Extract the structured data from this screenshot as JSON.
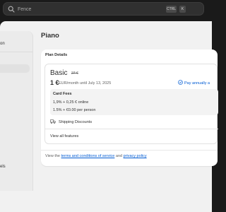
{
  "search": {
    "placeholder": "Fence",
    "shortcut_ctrl": "CTRL",
    "shortcut_key": "K"
  },
  "sidebar": {
    "item_top_fragment": "on",
    "item_bottom_fragment": "els"
  },
  "page": {
    "title": "Piano"
  },
  "plan_details": {
    "section_title": "Plan Details",
    "plan_name": "Basic",
    "old_price": "27 €",
    "price": "1 €",
    "price_note": "EUR/month until July 13, 2025",
    "pay_annually_label": "Pay annually a",
    "card_fees": {
      "title": "Card Fees",
      "online": "1,9% + 0,25 € online",
      "in_person": "1.5% + €0.00 per person"
    },
    "shipping_label": "Shipping Discounts",
    "view_all_label": "View all features"
  },
  "footer": {
    "prefix": "View the",
    "terms_link": "terms and conditions of service",
    "conjunction": "and",
    "privacy_link": "privacy policy"
  },
  "colors": {
    "link": "#005bd3",
    "background": "#f1f1f1",
    "topbar": "#1a1a1a"
  },
  "icons": {
    "search": "search-icon",
    "pay_annually": "recurring-icon",
    "shipping": "truck-icon"
  }
}
